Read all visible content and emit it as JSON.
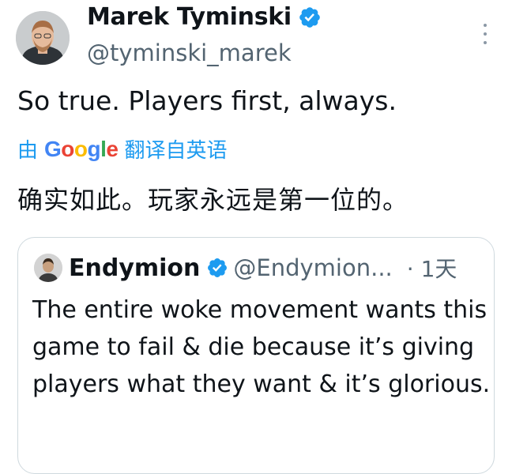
{
  "author": {
    "display_name": "Marek Tyminski",
    "handle": "@tyminski_marek"
  },
  "tweet": {
    "text": "So true. Players first, always."
  },
  "translation": {
    "prefix": "由",
    "provider": "Google",
    "suffix": "翻译自英语",
    "text": "确实如此。玩家永远是第一位的。"
  },
  "quoted": {
    "display_name": "Endymion",
    "handle": "@Endymion...",
    "time": "· 1天",
    "text": "The entire woke movement wants this game to fail & die because it’s giving players what they want & it’s glorious."
  },
  "colors": {
    "link": "#1d9bf0",
    "verified": "#1d9bf0",
    "secondary_text": "#536471"
  },
  "icons": {
    "verified": "verified-badge-icon",
    "more": "more-vertical-icon"
  }
}
